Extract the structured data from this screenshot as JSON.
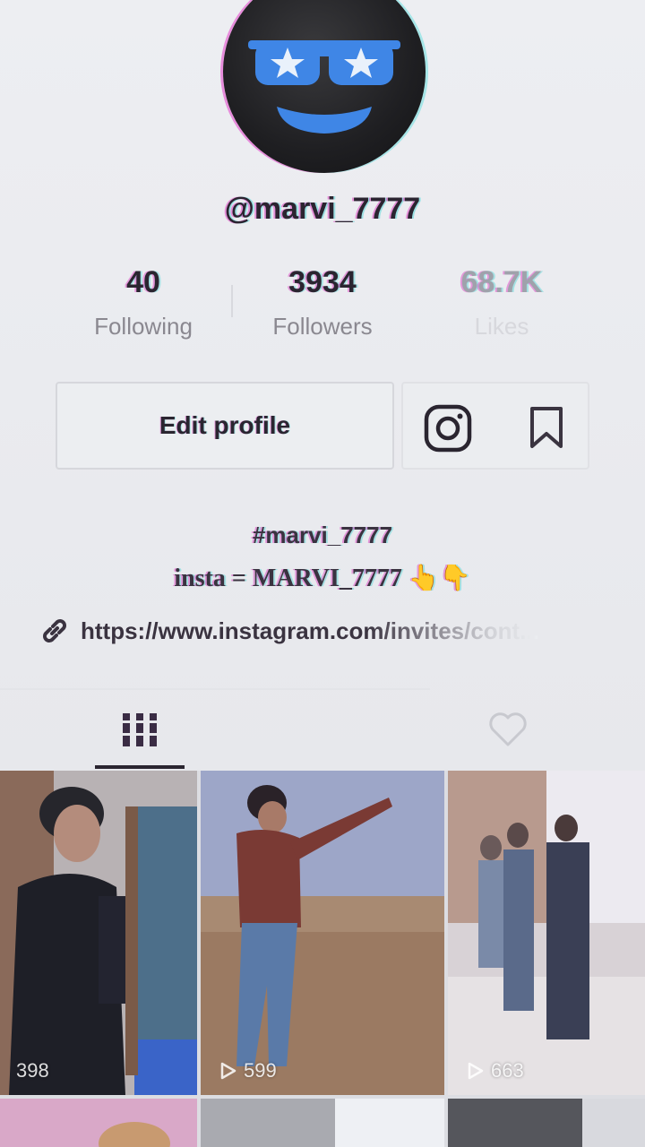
{
  "profile": {
    "username": "@marvi_7777",
    "avatar_icon": "sunglasses-smiley-icon"
  },
  "stats": [
    {
      "value": "40",
      "label": "Following"
    },
    {
      "value": "3934",
      "label": "Followers"
    },
    {
      "value": "68.7K",
      "label": "Likes"
    }
  ],
  "actions": {
    "edit_profile": "Edit profile",
    "instagram_icon": "instagram-icon",
    "bookmark_icon": "bookmark-icon"
  },
  "bio": {
    "hashtag": "#marvi_7777",
    "line": "insta = MARVI_7777 👆👇",
    "link": "https://www.instagram.com/invites/cont..."
  },
  "tabs": [
    {
      "icon": "grid-icon",
      "active": true
    },
    {
      "icon": "heart-icon",
      "active": false
    }
  ],
  "videos": [
    {
      "views": "398"
    },
    {
      "views": "599"
    },
    {
      "views": "663"
    }
  ],
  "colors": {
    "background": "#e9eaee",
    "text": "#2a2530",
    "muted": "#8a8890",
    "glitch_magenta": "#dc32be",
    "glitch_cyan": "#3cd2d2",
    "avatar_blue": "#3a7de0"
  }
}
